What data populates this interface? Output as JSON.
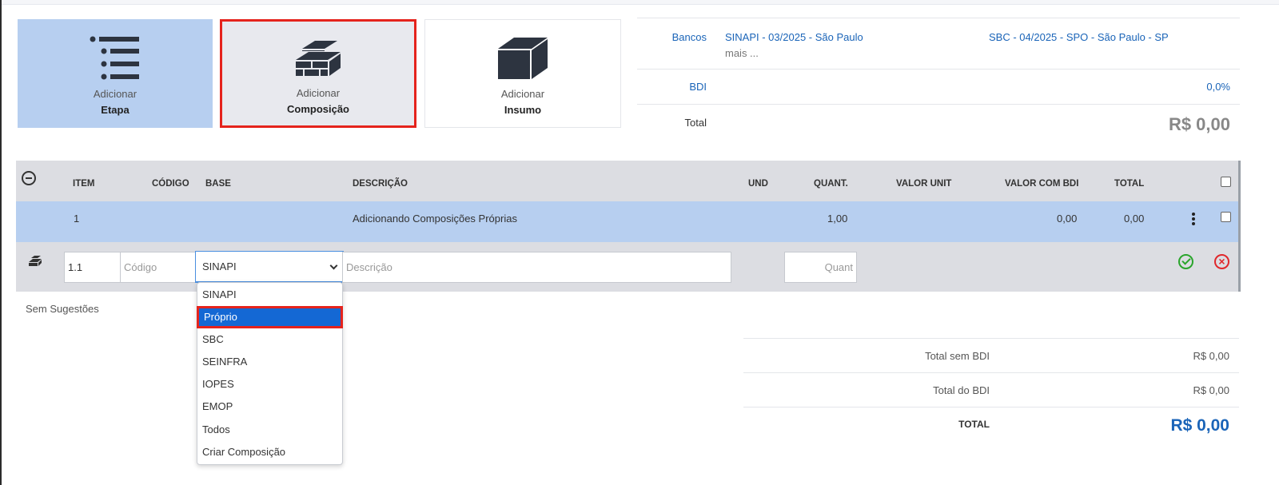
{
  "tiles": [
    {
      "line1": "Adicionar",
      "line2": "Etapa",
      "icon": "list-icon"
    },
    {
      "line1": "Adicionar",
      "line2": "Composição",
      "icon": "bricks-icon"
    },
    {
      "line1": "Adicionar",
      "line2": "Insumo",
      "icon": "block-icon"
    }
  ],
  "summary": {
    "banks_label": "Bancos",
    "bank1": "SINAPI - 03/2025 - São Paulo",
    "more": "mais ...",
    "bank2": "SBC - 04/2025 - SPO - São Paulo - SP",
    "bdi_label": "BDI",
    "bdi_value": "0,0%",
    "total_label": "Total",
    "total_value": "R$ 0,00"
  },
  "table": {
    "headers": [
      "ITEM",
      "CÓDIGO",
      "BASE",
      "DESCRIÇÃO",
      "UND",
      "QUANT.",
      "VALOR UNIT",
      "VALOR COM BDI",
      "TOTAL"
    ],
    "row1": {
      "item": "1",
      "descricao": "Adicionando Composições Próprias",
      "quant": "1,00",
      "valor_com_bdi": "0,00",
      "total": "0,00"
    },
    "edit_row": {
      "item_value": "1.1",
      "codigo_placeholder": "Código",
      "base_value": "SINAPI",
      "descricao_placeholder": "Descrição",
      "quant_placeholder": "Quant"
    }
  },
  "suggestions": "Sem Sugestões",
  "dropdown": {
    "options": [
      "SINAPI",
      "Próprio",
      "SBC",
      "SEINFRA",
      "IOPES",
      "EMOP",
      "Todos",
      "Criar Composição"
    ],
    "highlighted": "Próprio"
  },
  "totals": [
    {
      "label": "Total sem BDI",
      "value": "R$ 0,00"
    },
    {
      "label": "Total do BDI",
      "value": "R$ 0,00"
    },
    {
      "label": "TOTAL",
      "value": "R$ 0,00"
    }
  ],
  "colors": {
    "accent": "#1a64b8",
    "selected_bg": "#b7cff0",
    "highlight_border": "#e5231c",
    "ok": "#2aa52c",
    "cancel": "#e0272b"
  }
}
